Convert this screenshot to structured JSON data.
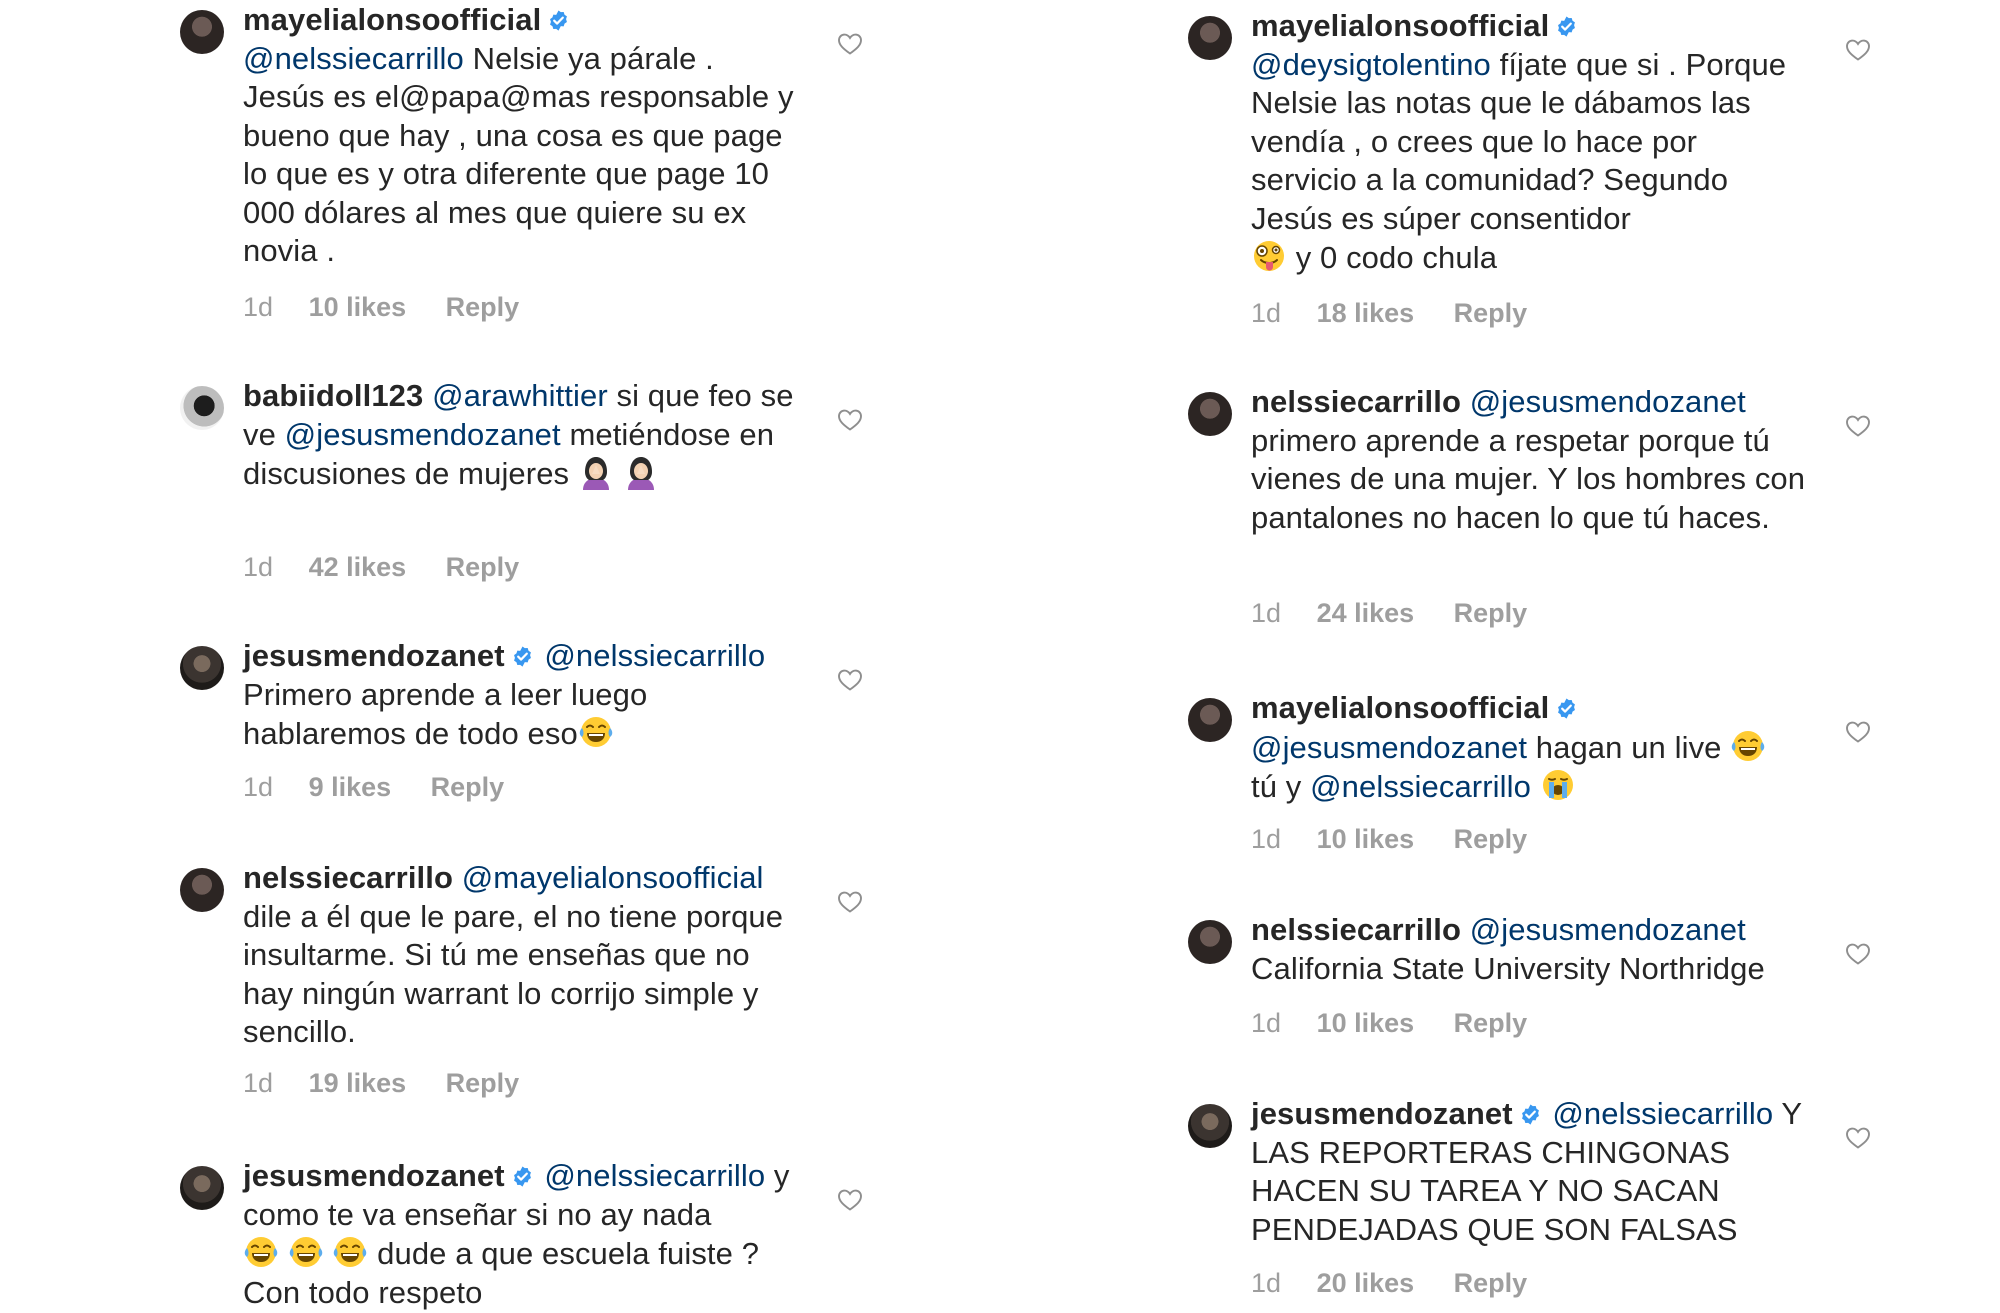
{
  "icons": {
    "verified": "verified-badge-icon",
    "like": "heart-outline-icon"
  },
  "colors": {
    "mention": "#00376b",
    "meta": "#9e9e9e",
    "verified": "#3897f0"
  },
  "left_comments": [
    {
      "username": "mayelialonsoofficial",
      "mention": "@nelssiecarrillo",
      "text": "Nelsie ya párale . Jesús es el@papa@mas responsable y bueno que hay , una cosa es que page lo que es y otra diferente que page 10 000 dólares al mes que quiere su ex novia .",
      "time": "1d",
      "likes": "10 likes",
      "reply": "Reply"
    },
    {
      "username": "babiidoll123",
      "mention": "@arawhittier",
      "text_a": "si que feo se ve",
      "mention_b": "@jesusmendozanet",
      "text_b": "metiéndose en discusiones de mujeres",
      "emoji": "person-facepalming-emoji",
      "time": "1d",
      "likes": "42 likes",
      "reply": "Reply"
    },
    {
      "username": "jesusmendozanet",
      "mention": "@nelssiecarrillo",
      "text": "Primero aprende a leer luego hablaremos de todo eso",
      "emoji": "laughing-tears-emoji",
      "time": "1d",
      "likes": "9 likes",
      "reply": "Reply"
    },
    {
      "username": "nelssiecarrillo",
      "mention": "@mayelialonsoofficial",
      "text": "dile a él que le pare, el no tiene porque insultarme. Si tú me enseñas que no hay ningún warrant lo corrijo simple y sencillo.",
      "time": "1d",
      "likes": "19 likes",
      "reply": "Reply"
    },
    {
      "username": "jesusmendozanet",
      "mention": "@nelssiecarrillo",
      "text_a": "y como te va enseñar si no ay nada",
      "text_b": "dude a que escuela fuiste ? Con todo respeto",
      "emoji": "laughing-tears-emoji"
    }
  ],
  "right_comments": [
    {
      "username": "mayelialonsoofficial",
      "mention": "@deysigtolentino",
      "text": "fíjate que si . Porque Nelsie las notas que le dábamos las vendía , o crees que lo hace por servicio a la comunidad? Segundo Jesús es súper consentidor",
      "emoji": "zany-face-emoji",
      "text_b": "y 0 codo chula",
      "time": "1d",
      "likes": "18 likes",
      "reply": "Reply"
    },
    {
      "username": "nelssiecarrillo",
      "mention": "@jesusmendozanet",
      "text": "primero aprende a respetar porque tú vienes de una mujer. Y los hombres con pantalones no hacen lo que tú haces.",
      "time": "1d",
      "likes": "24 likes",
      "reply": "Reply"
    },
    {
      "username": "mayelialonsoofficial",
      "mention": "@jesusmendozanet",
      "text_a": "hagan un live",
      "text_b": "tú y",
      "mention_b": "@nelssiecarrillo",
      "emoji_a": "laughing-tears-emoji",
      "emoji_b": "loudly-crying-emoji",
      "time": "1d",
      "likes": "10 likes",
      "reply": "Reply"
    },
    {
      "username": "nelssiecarrillo",
      "mention": "@jesusmendozanet",
      "text": "California State University Northridge",
      "time": "1d",
      "likes": "10 likes",
      "reply": "Reply"
    },
    {
      "username": "jesusmendozanet",
      "mention": "@nelssiecarrillo",
      "text": "Y LAS REPORTERAS CHINGONAS HACEN SU TAREA Y NO SACAN PENDEJADAS QUE SON FALSAS",
      "time": "1d",
      "likes": "20 likes",
      "reply": "Reply"
    }
  ]
}
